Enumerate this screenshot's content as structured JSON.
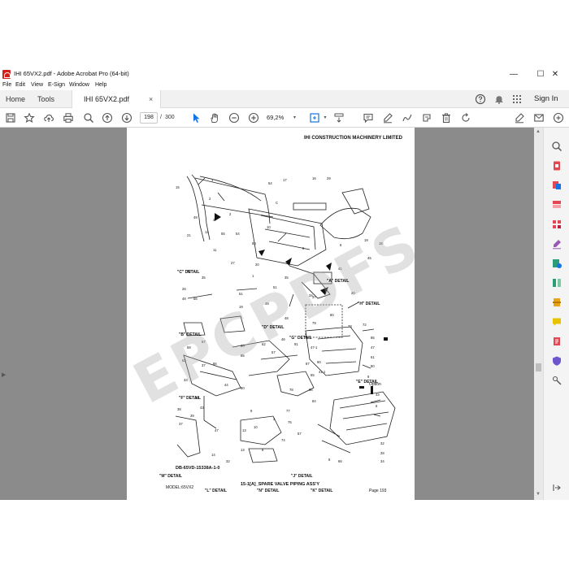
{
  "window": {
    "title": "IHI 65VX2.pdf - Adobe Acrobat Pro (64-bit)",
    "minimize": "—",
    "maximize": "☐",
    "close": "✕"
  },
  "menu": [
    "File",
    "Edit",
    "View",
    "E-Sign",
    "Window",
    "Help"
  ],
  "tabs": {
    "home": "Home",
    "tools": "Tools",
    "document": "IHI 65VX2.pdf",
    "close": "×",
    "signin": "Sign In"
  },
  "toolbar": {
    "current_page": "198",
    "page_separator": "/",
    "total_pages": "300",
    "zoom": "69,2%"
  },
  "page": {
    "header": "IHI CONSTRUCTION MACHINERY LIMITED",
    "watermark": "EPCPDFS.COM",
    "drawing_number": "DB-65VD-15338A-1-0",
    "footer_model": "MODEL:65VX2",
    "footer_title": "15-1[A]_SPARE VALVE PIPING ASS'Y",
    "footer_page": "Page 193",
    "option_label": "Option",
    "details": [
      "\"A\" DETAIL",
      "\"B\" DETAIL",
      "\"C\" DETAIL",
      "\"D\" DETAIL",
      "\"E\" DETAIL",
      "\"F\" DETAIL",
      "\"G\" DETAIL",
      "\"H\" DETAIL",
      "\"J\" DETAIL",
      "\"K\" DETAIL",
      "\"L\" DETAIL",
      "\"M\" DETAIL",
      "\"N\" DETAIL"
    ]
  },
  "colors": {
    "acrobat_red": "#d1231b",
    "doc_background": "#8b8b8b",
    "accent_blue": "#1473e6"
  }
}
